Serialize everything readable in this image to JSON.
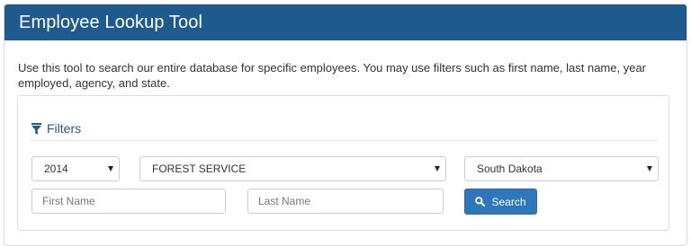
{
  "header": {
    "title": "Employee Lookup Tool"
  },
  "description": "Use this tool to search our entire database for specific employees. You may use filters such as first name, last name, year employed, agency, and state.",
  "filters": {
    "heading": "Filters",
    "year_select": {
      "value": "2014"
    },
    "agency_select": {
      "value": "FOREST SERVICE"
    },
    "state_select": {
      "value": "South Dakota"
    },
    "first_name": {
      "placeholder": "First Name"
    },
    "last_name": {
      "placeholder": "Last Name"
    },
    "search_button": {
      "label": "Search"
    }
  },
  "icons": {
    "filter": "filter-icon",
    "search": "search-icon",
    "dropdown": "chevron-down-icon"
  },
  "colors": {
    "header_bg": "#1e5a8e",
    "accent": "#1e5a8e",
    "button_bg": "#2f77b8"
  }
}
